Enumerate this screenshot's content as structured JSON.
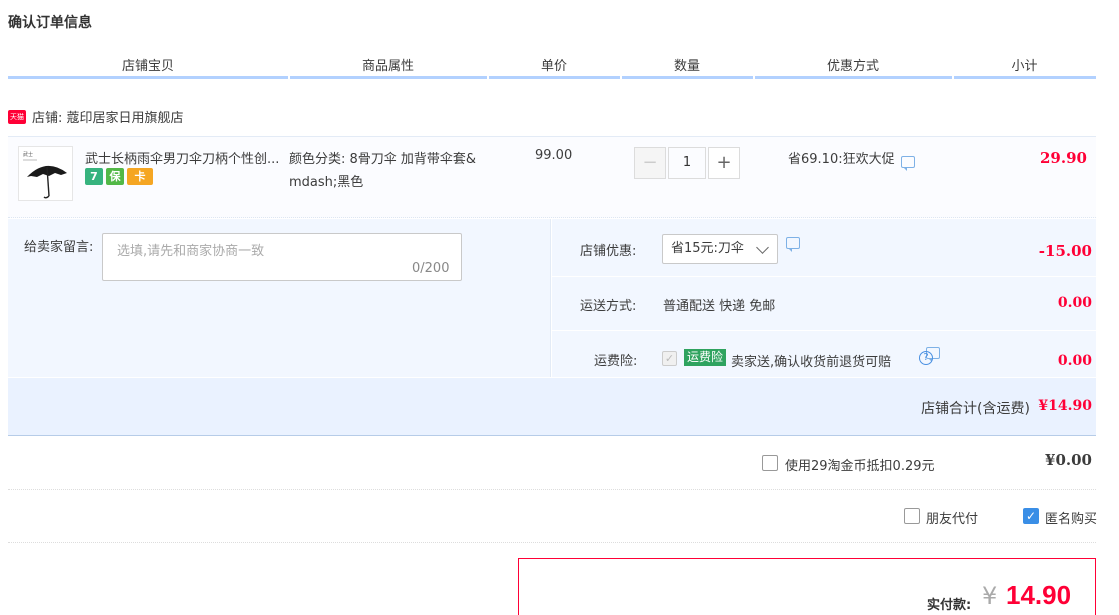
{
  "page_title": "确认订单信息",
  "columns": [
    "店铺宝贝",
    "商品属性",
    "单价",
    "数量",
    "优惠方式",
    "小计"
  ],
  "shop": {
    "badge": "天猫",
    "name": "店铺: 蔻印居家日用旗舰店"
  },
  "item": {
    "title": "武士长柄雨伞男刀伞刀柄个性创...",
    "thumb_caption": "武士",
    "attr_line1": "颜色分类: 8骨刀伞 加背带伞套&",
    "attr_line2": "mdash;黑色",
    "service_icons": [
      "7",
      "保",
      "卡"
    ],
    "unit_price": "99.00",
    "quantity": "1",
    "minus": "−",
    "plus": "+",
    "promo": "省69.10:狂欢大促",
    "subtotal": "29.90"
  },
  "message": {
    "label": "给卖家留言:",
    "placeholder": "选填,请先和商家协商一致",
    "count": "0/200"
  },
  "shop_discount": {
    "label": "店铺优惠:",
    "selected": "省15元:刀伞",
    "amount": "-15.00"
  },
  "shipping": {
    "label": "运送方式:",
    "value": "普通配送 快递 免邮",
    "amount": "0.00"
  },
  "insurance": {
    "label": "运费险:",
    "badge": "运费险",
    "text": "卖家送,确认收货前退货可赔",
    "help": "?",
    "amount": "0.00"
  },
  "shop_total": {
    "label": "店铺合计(含运费)",
    "value": "¥14.90"
  },
  "coins": {
    "label": "使用29淘金币抵扣0.29元",
    "value": "¥0.00",
    "checked": false
  },
  "friend_pay": {
    "label": "朋友代付",
    "checked": false
  },
  "anonymous": {
    "label": "匿名购买",
    "checked": true
  },
  "payment": {
    "label": "实付款:",
    "currency": "¥",
    "value": "14.90"
  },
  "colors": {
    "accent_red": "#ff0036",
    "header_line": "#b2d1ff",
    "panel_bg": "#f2f7ff",
    "checkbox_blue": "#3a8ee6",
    "insurance_green": "#2fa35f"
  }
}
